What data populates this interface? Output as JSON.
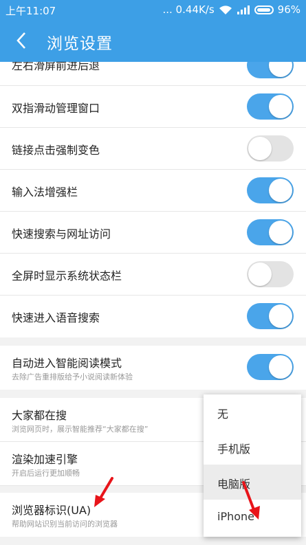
{
  "status_bar": {
    "time": "上午11:07",
    "network_speed": "... 0.44K/s",
    "battery": "96%"
  },
  "header": {
    "title": "浏览设置"
  },
  "settings": {
    "partial_row": {
      "label": "左右滑屏前进后退",
      "on": true
    },
    "group1": [
      {
        "label": "双指滑动管理窗口",
        "on": true
      },
      {
        "label": "链接点击强制变色",
        "on": false
      },
      {
        "label": "输入法增强栏",
        "on": true
      },
      {
        "label": "快速搜索与网址访问",
        "on": true
      },
      {
        "label": "全屏时显示系统状态栏",
        "on": false
      },
      {
        "label": "快速进入语音搜索",
        "on": true
      }
    ],
    "reading_mode": {
      "label": "自动进入智能阅读模式",
      "sub": "去除广告重排版给予小说阅读新体验",
      "on": true
    },
    "everyone_search": {
      "label": "大家都在搜",
      "sub": "浏览网页时，展示智能推荐“大家都在搜”"
    },
    "render_engine": {
      "label": "渲染加速引擎",
      "sub": "开启后运行更加顺畅"
    },
    "ua": {
      "label": "浏览器标识(UA)",
      "sub": "帮助网站识别当前访问的浏览器"
    }
  },
  "ua_menu": {
    "options": [
      "无",
      "手机版",
      "电脑版",
      "iPhone"
    ],
    "selected_index": 2
  },
  "colors": {
    "primary": "#3d9fe6",
    "toggle_on": "#4aa5ea",
    "arrow": "#e8141a"
  }
}
